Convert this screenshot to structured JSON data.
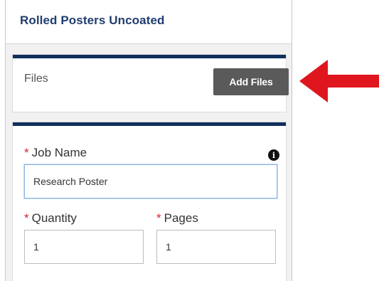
{
  "header": {
    "title": "Rolled Posters Uncoated"
  },
  "files": {
    "label": "Files",
    "add_button_label": "Add Files"
  },
  "job_form": {
    "required_marker": "*",
    "job_name": {
      "label": "Job Name",
      "value": "Research Poster",
      "info_icon": "info-icon"
    },
    "quantity": {
      "label": "Quantity",
      "value": "1"
    },
    "pages": {
      "label": "Pages",
      "value": "1"
    }
  },
  "annotation": {
    "icon": "arrow-left-icon",
    "color": "#e0161e"
  },
  "colors": {
    "header_text": "#1f3d6e",
    "card_accent": "#0f2f5c",
    "button_bg": "#5a5a5a",
    "required": "#d0262d"
  }
}
